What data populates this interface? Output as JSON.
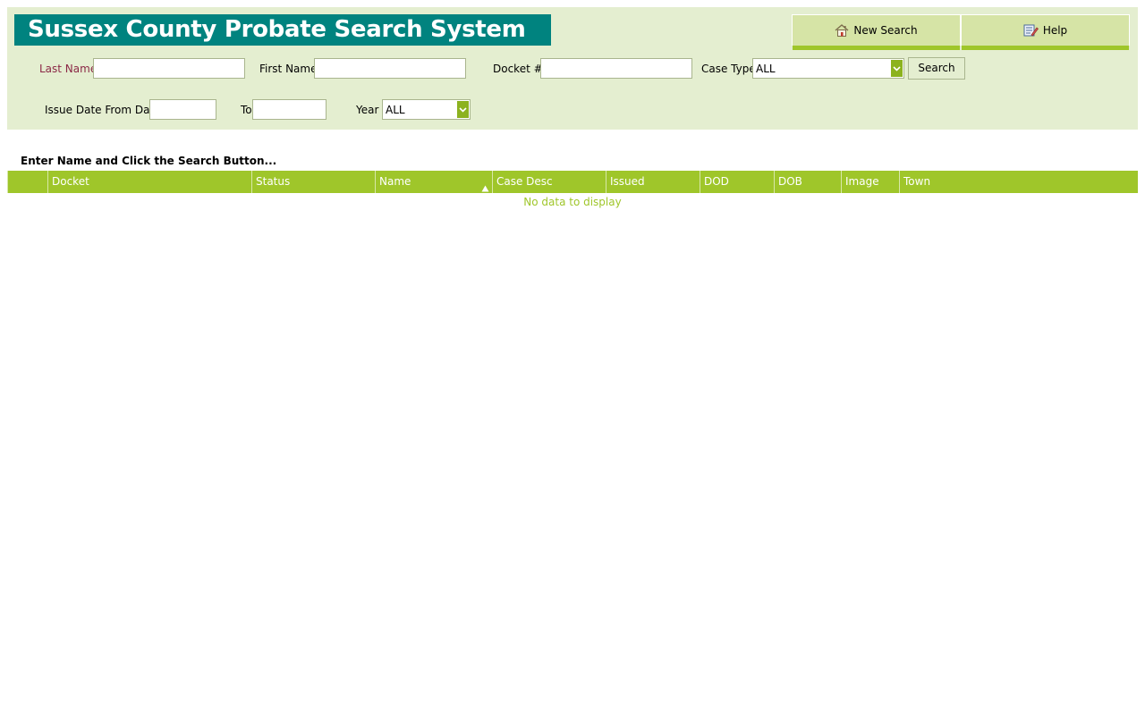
{
  "header": {
    "title": "Sussex County Probate Search System",
    "nav": {
      "new_search": "New Search",
      "help": "Help"
    }
  },
  "search_form": {
    "last_name_label": "Last Name",
    "last_name_value": "",
    "first_name_label": "First Name",
    "first_name_value": "",
    "docket_label": "Docket #",
    "docket_value": "",
    "case_type_label": "Case Type",
    "case_type_value": "ALL",
    "search_button": "Search",
    "issue_date_from_label": "Issue Date From Date",
    "issue_date_from_value": "",
    "to_label": "To",
    "to_value": "",
    "year_label": "Year",
    "year_value": "ALL"
  },
  "results": {
    "instructions": "Enter Name and Click the Search Button...",
    "columns": [
      "",
      "Docket",
      "Status",
      "Name",
      "Case Desc",
      "Issued",
      "DOD",
      "DOB",
      "Image",
      "Town"
    ],
    "sorted_column": "Name",
    "sort_direction": "ascending",
    "empty_message": "No data to display",
    "rows": []
  },
  "colors": {
    "title_banner": "#00837f",
    "panel_background": "#e4eed0",
    "grid_header": "#9fc62a",
    "last_name_label": "#8b2846"
  }
}
